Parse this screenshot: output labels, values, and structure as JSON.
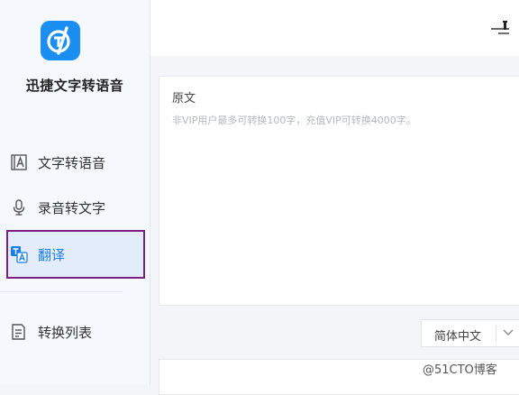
{
  "app": {
    "title": "迅捷文字转语音"
  },
  "sidebar": {
    "items": [
      {
        "label": "文字转语音",
        "icon": "text-document-icon"
      },
      {
        "label": "录音转文字",
        "icon": "microphone-icon"
      },
      {
        "label": "翻译",
        "icon": "translate-icon",
        "active": true
      },
      {
        "label": "转换列表",
        "icon": "list-icon"
      }
    ]
  },
  "editor": {
    "source_label": "原文",
    "placeholder": "非VIP用户最多可转换100字，充值VIP可转换4000字。",
    "target_language": "简体中文"
  },
  "watermark": "@51CTO博客",
  "colors": {
    "accent": "#1b8ff1",
    "active_border": "#7b1f86",
    "active_bg": "#e2ecfa"
  }
}
